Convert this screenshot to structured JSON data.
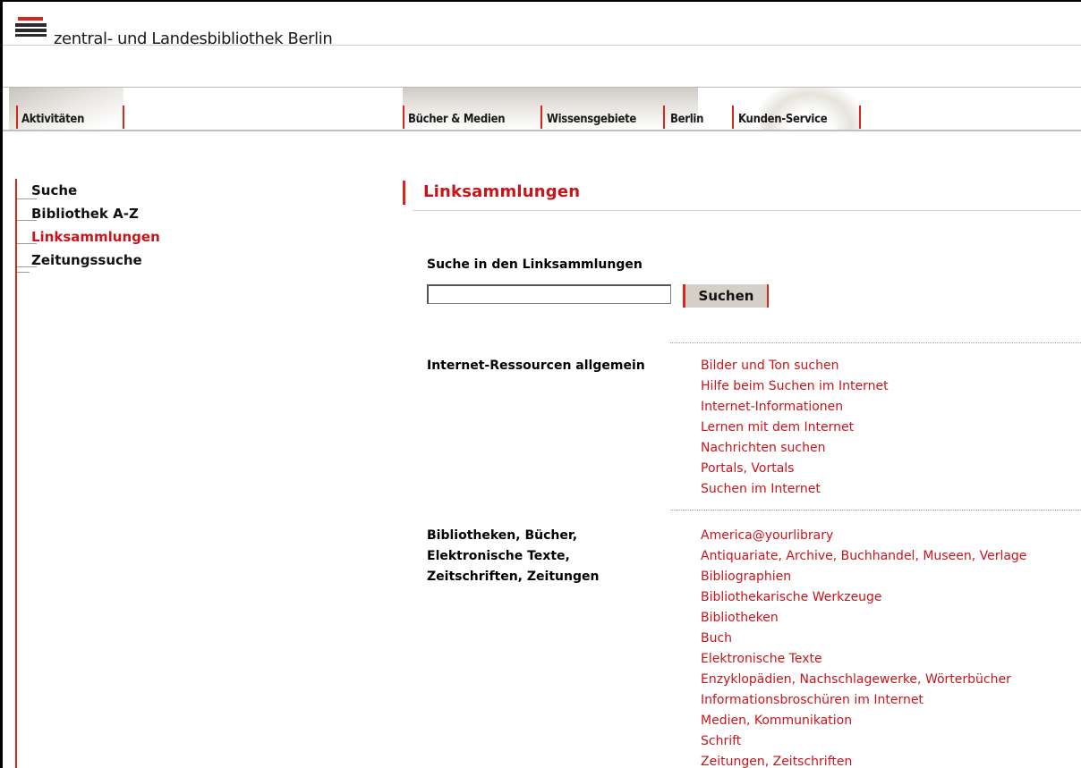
{
  "header": {
    "logo_text": "zentral- und Landesbibliothek Berlin"
  },
  "nav": {
    "items": [
      "Aktivitäten",
      "Bücher & Medien",
      "Wissensgebiete",
      "Berlin",
      "Kunden-Service"
    ]
  },
  "sidebar": {
    "items": [
      {
        "label": "Suche",
        "active": false
      },
      {
        "label": "Bibliothek A-Z",
        "active": false
      },
      {
        "label": "Linksammlungen",
        "active": true
      },
      {
        "label": "Zeitungssuche",
        "active": false
      }
    ]
  },
  "main": {
    "title": "Linksammlungen",
    "search": {
      "label": "Suche in den Linksammlungen",
      "value": "",
      "button_label": "Suchen"
    },
    "categories": [
      {
        "label_lines": [
          "Internet-Ressourcen allgemein"
        ],
        "links": [
          "Bilder und Ton suchen",
          "Hilfe beim Suchen im Internet",
          "Internet-Informationen",
          "Lernen mit dem Internet",
          "Nachrichten suchen",
          "Portals, Vortals",
          "Suchen im Internet"
        ]
      },
      {
        "label_lines": [
          "Bibliotheken, Bücher,",
          "Elektronische Texte,",
          "Zeitschriften, Zeitungen"
        ],
        "links": [
          "America@yourlibrary",
          "Antiquariate, Archive, Buchhandel, Museen, Verlage",
          "Bibliographien",
          "Bibliothekarische Werkzeuge",
          "Bibliotheken",
          "Buch",
          "Elektronische Texte",
          "Enzyklopädien, Nachschlagewerke, Wörterbücher",
          "Informationsbroschüren im Internet",
          "Medien, Kommunikation",
          "Schrift",
          "Zeitungen, Zeitschriften"
        ]
      }
    ]
  },
  "colors": {
    "accent": "#c8141b",
    "logo_bar": "#d9261c"
  }
}
